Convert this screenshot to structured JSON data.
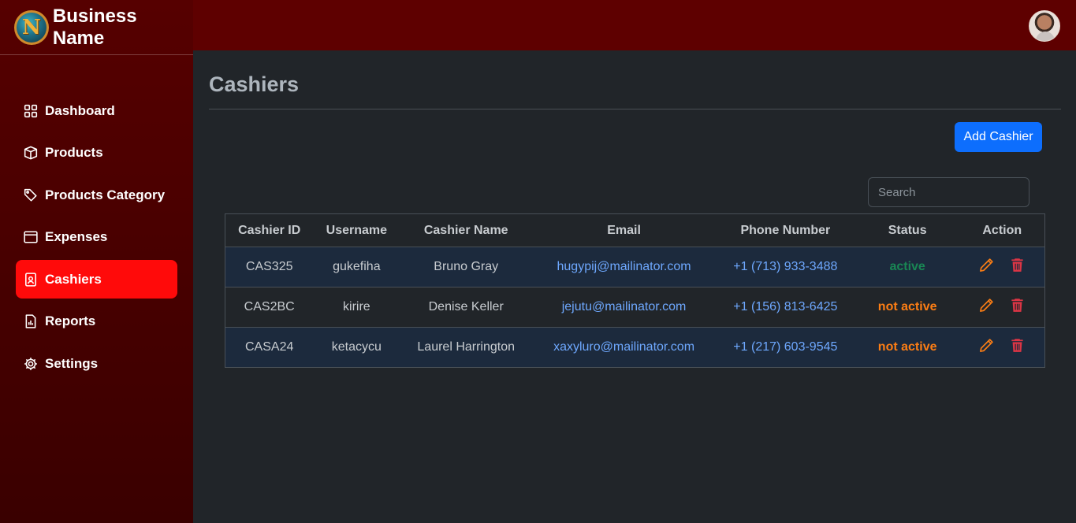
{
  "brand": {
    "logo_letter": "N",
    "name": "Business Name"
  },
  "sidebar": {
    "items": [
      {
        "label": "Dashboard",
        "icon": "grid-icon"
      },
      {
        "label": "Products",
        "icon": "box-icon"
      },
      {
        "label": "Products Category",
        "icon": "tags-icon"
      },
      {
        "label": "Expenses",
        "icon": "window-icon"
      },
      {
        "label": "Cashiers",
        "icon": "person-badge-icon",
        "active": true
      },
      {
        "label": "Reports",
        "icon": "file-chart-icon"
      },
      {
        "label": "Settings",
        "icon": "gear-icon"
      }
    ]
  },
  "page": {
    "title": "Cashiers",
    "add_button": "Add Cashier",
    "search_placeholder": "Search"
  },
  "table": {
    "headers": [
      "Cashier ID",
      "Username",
      "Cashier Name",
      "Email",
      "Phone Number",
      "Status",
      "Action"
    ],
    "rows": [
      {
        "id": "CAS325",
        "username": "gukefiha",
        "name": "Bruno Gray",
        "email": "hugypij@mailinator.com",
        "phone": "+1 (713) 933-3488",
        "status": "active"
      },
      {
        "id": "CAS2BC",
        "username": "kirire",
        "name": "Denise Keller",
        "email": "jejutu@mailinator.com",
        "phone": "+1 (156) 813-6425",
        "status": "not active"
      },
      {
        "id": "CASA24",
        "username": "ketacycu",
        "name": "Laurel Harrington",
        "email": "xaxyluro@mailinator.com",
        "phone": "+1 (217) 603-9545",
        "status": "not active"
      }
    ]
  },
  "colors": {
    "sidebar": "#560000",
    "topbar": "#5e0000",
    "active_nav": "#ff0a0a",
    "primary": "#0d6efd",
    "status_active": "#198754",
    "status_inactive": "#fd7e14",
    "edit_icon": "#fd7e14",
    "delete_icon": "#dc3545"
  }
}
